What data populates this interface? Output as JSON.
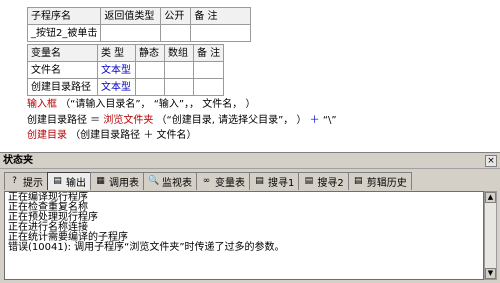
{
  "sub_table": {
    "headers": [
      "子程序名",
      "返回值类型",
      "公开",
      "备 注"
    ],
    "row": [
      "_按钮2_被单击",
      "",
      "",
      ""
    ]
  },
  "var_table": {
    "headers": [
      "变量名",
      "类 型",
      "静态",
      "数组",
      "备 注"
    ],
    "rows": [
      [
        "文件名",
        "文本型",
        "",
        "",
        ""
      ],
      [
        "创建目录路径",
        "文本型",
        "",
        "",
        ""
      ]
    ]
  },
  "code": {
    "line1": {
      "fn": "输入框",
      "args": "（“请输入目录名”， “输入”，， 文件名， ）"
    },
    "line2": {
      "target": "创建目录路径 ＝ ",
      "fn": "浏览文件夹",
      "args": "（“创建目录, 请选择父目录”， ）",
      "plus": " ＋ ",
      "tail": "“\\”"
    },
    "line3": {
      "fn": "创建目录",
      "args": "（创建目录路径 ＋ 文件名）"
    }
  },
  "panel": {
    "title": "状态夹",
    "close_label": "×",
    "tabs": [
      {
        "label": "提示",
        "icon": "?"
      },
      {
        "label": "输出",
        "icon": "▤"
      },
      {
        "label": "调用表",
        "icon": "▦"
      },
      {
        "label": "监视表",
        "icon": "🔍"
      },
      {
        "label": "变量表",
        "icon": "∞"
      },
      {
        "label": "搜寻1",
        "icon": "▤"
      },
      {
        "label": "搜寻2",
        "icon": "▤"
      },
      {
        "label": "剪辑历史",
        "icon": "▤"
      }
    ],
    "active_tab": "输出",
    "output_lines": [
      "正在编译现行程序",
      "正在检查重复名称",
      "正在预处理现行程序",
      "正在进行名称连接",
      "正在统计需要编译的子程序",
      "错误(10041): 调用子程序“浏览文件夹”时传递了过多的参数。"
    ]
  }
}
